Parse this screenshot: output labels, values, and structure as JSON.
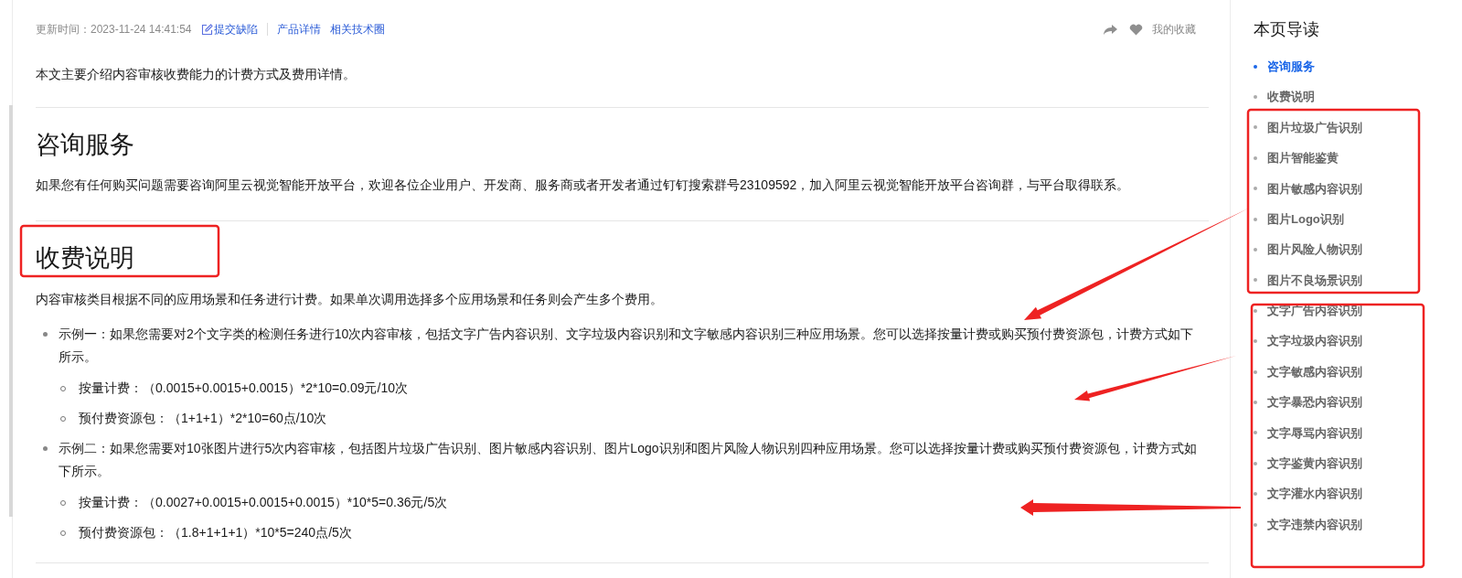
{
  "meta": {
    "update_label": "更新时间：2023-11-24 14:41:54",
    "links": [
      {
        "text": "提交缺陷",
        "kind": "edit"
      },
      {
        "text": "产品详情",
        "kind": "plain"
      },
      {
        "text": "相关技术圈",
        "kind": "plain"
      }
    ],
    "favorite": "我的收藏"
  },
  "intro": "本文主要介绍内容审核收费能力的计费方式及费用详情。",
  "sections": [
    {
      "heading": "咨询服务",
      "paragraph": "如果您有任何购买问题需要咨询阿里云视觉智能开放平台，欢迎各位企业用户、开发商、服务商或者开发者通过钉钉搜索群号23109592，加入阿里云视觉智能开放平台咨询群，与平台取得联系。"
    },
    {
      "heading": "收费说明",
      "paragraph": "内容审核类目根据不同的应用场景和任务进行计费。如果单次调用选择多个应用场景和任务则会产生多个费用。",
      "items": [
        {
          "text": "示例一：如果您需要对2个文字类的检测任务进行10次内容审核，包括文字广告内容识别、文字垃圾内容识别和文字敏感内容识别三种应用场景。您可以选择按量计费或购买预付费资源包，计费方式如下所示。",
          "children": [
            "按量计费：（0.0015+0.0015+0.0015）*2*10=0.09元/10次",
            "预付费资源包：（1+1+1）*2*10=60点/10次"
          ]
        },
        {
          "text": "示例二：如果您需要对10张图片进行5次内容审核，包括图片垃圾广告识别、图片敏感内容识别、图片Logo识别和图片风险人物识别四种应用场景。您可以选择按量计费或购买预付费资源包，计费方式如下所示。",
          "children": [
            "按量计费：（0.0027+0.0015+0.0015+0.0015）*10*5=0.36元/5次",
            "预付费资源包：（1.8+1+1+1）*10*5=240点/5次"
          ]
        }
      ]
    }
  ],
  "toc": {
    "title": "本页导读",
    "items": [
      {
        "label": "咨询服务",
        "selected": true
      },
      {
        "label": "收费说明",
        "selected": false
      },
      {
        "label": "图片垃圾广告识别",
        "selected": false
      },
      {
        "label": "图片智能鉴黄",
        "selected": false
      },
      {
        "label": "图片敏感内容识别",
        "selected": false
      },
      {
        "label": "图片Logo识别",
        "selected": false
      },
      {
        "label": "图片风险人物识别",
        "selected": false
      },
      {
        "label": "图片不良场景识别",
        "selected": false
      },
      {
        "label": "文字广告内容识别",
        "selected": false
      },
      {
        "label": "文字垃圾内容识别",
        "selected": false
      },
      {
        "label": "文字敏感内容识别",
        "selected": false
      },
      {
        "label": "文字暴恐内容识别",
        "selected": false
      },
      {
        "label": "文字辱骂内容识别",
        "selected": false
      },
      {
        "label": "文字鉴黄内容识别",
        "selected": false
      },
      {
        "label": "文字灌水内容识别",
        "selected": false
      },
      {
        "label": "文字违禁内容识别",
        "selected": false
      }
    ]
  }
}
